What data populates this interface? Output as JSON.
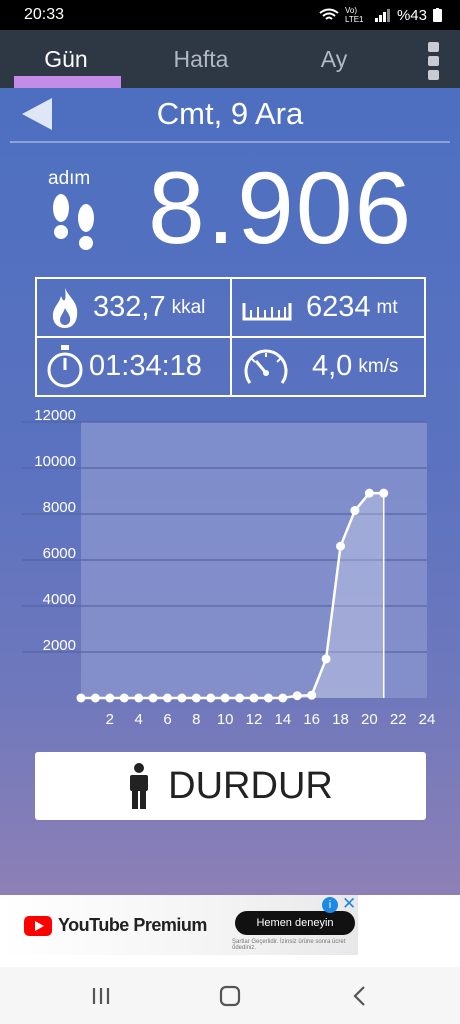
{
  "status_bar": {
    "time": "20:33",
    "network": "Vo) LTE1",
    "battery": "%43"
  },
  "tabs": [
    {
      "label": "Gün",
      "active": true
    },
    {
      "label": "Hafta",
      "active": false
    },
    {
      "label": "Ay",
      "active": false
    }
  ],
  "date_label": "Cmt, 9 Ara",
  "steps": {
    "label": "adım",
    "value": "8.906"
  },
  "stats": {
    "calories": {
      "value": "332,7",
      "unit": "kkal"
    },
    "distance": {
      "value": "6234",
      "unit": "mt"
    },
    "duration": {
      "value": "01:34:18"
    },
    "speed": {
      "value": "4,0",
      "unit": "km/s"
    }
  },
  "chart_data": {
    "type": "area",
    "x": [
      0,
      1,
      2,
      3,
      4,
      5,
      6,
      7,
      8,
      9,
      10,
      11,
      12,
      13,
      14,
      15,
      16,
      17,
      18,
      19,
      20,
      21
    ],
    "values": [
      0,
      0,
      0,
      0,
      0,
      0,
      0,
      0,
      0,
      0,
      0,
      0,
      0,
      0,
      0,
      100,
      120,
      1700,
      6600,
      8150,
      8906,
      8906
    ],
    "x_ticks": [
      "2",
      "4",
      "6",
      "8",
      "10",
      "12",
      "14",
      "16",
      "18",
      "20",
      "22",
      "24"
    ],
    "y_ticks": [
      "2000",
      "4000",
      "6000",
      "8000",
      "10000",
      "12000"
    ],
    "ylim": [
      0,
      12000
    ],
    "xlim": [
      0,
      24
    ],
    "grid": true
  },
  "stop_button": {
    "label": "DURDUR"
  },
  "ad": {
    "brand": "YouTube Premium",
    "cta": "Hemen deneyin",
    "fine_print": "Şartlar Geçerlidir. İzinsiz ürüne sonra ücret ödediniz."
  },
  "colors": {
    "tab_bar": "#2e3744",
    "tab_indicator": "#c48ce6",
    "background_top": "#4d6fc0",
    "background_bottom": "#8d80b6",
    "chart_plot": "#8b97cf",
    "line": "#ffffff"
  }
}
